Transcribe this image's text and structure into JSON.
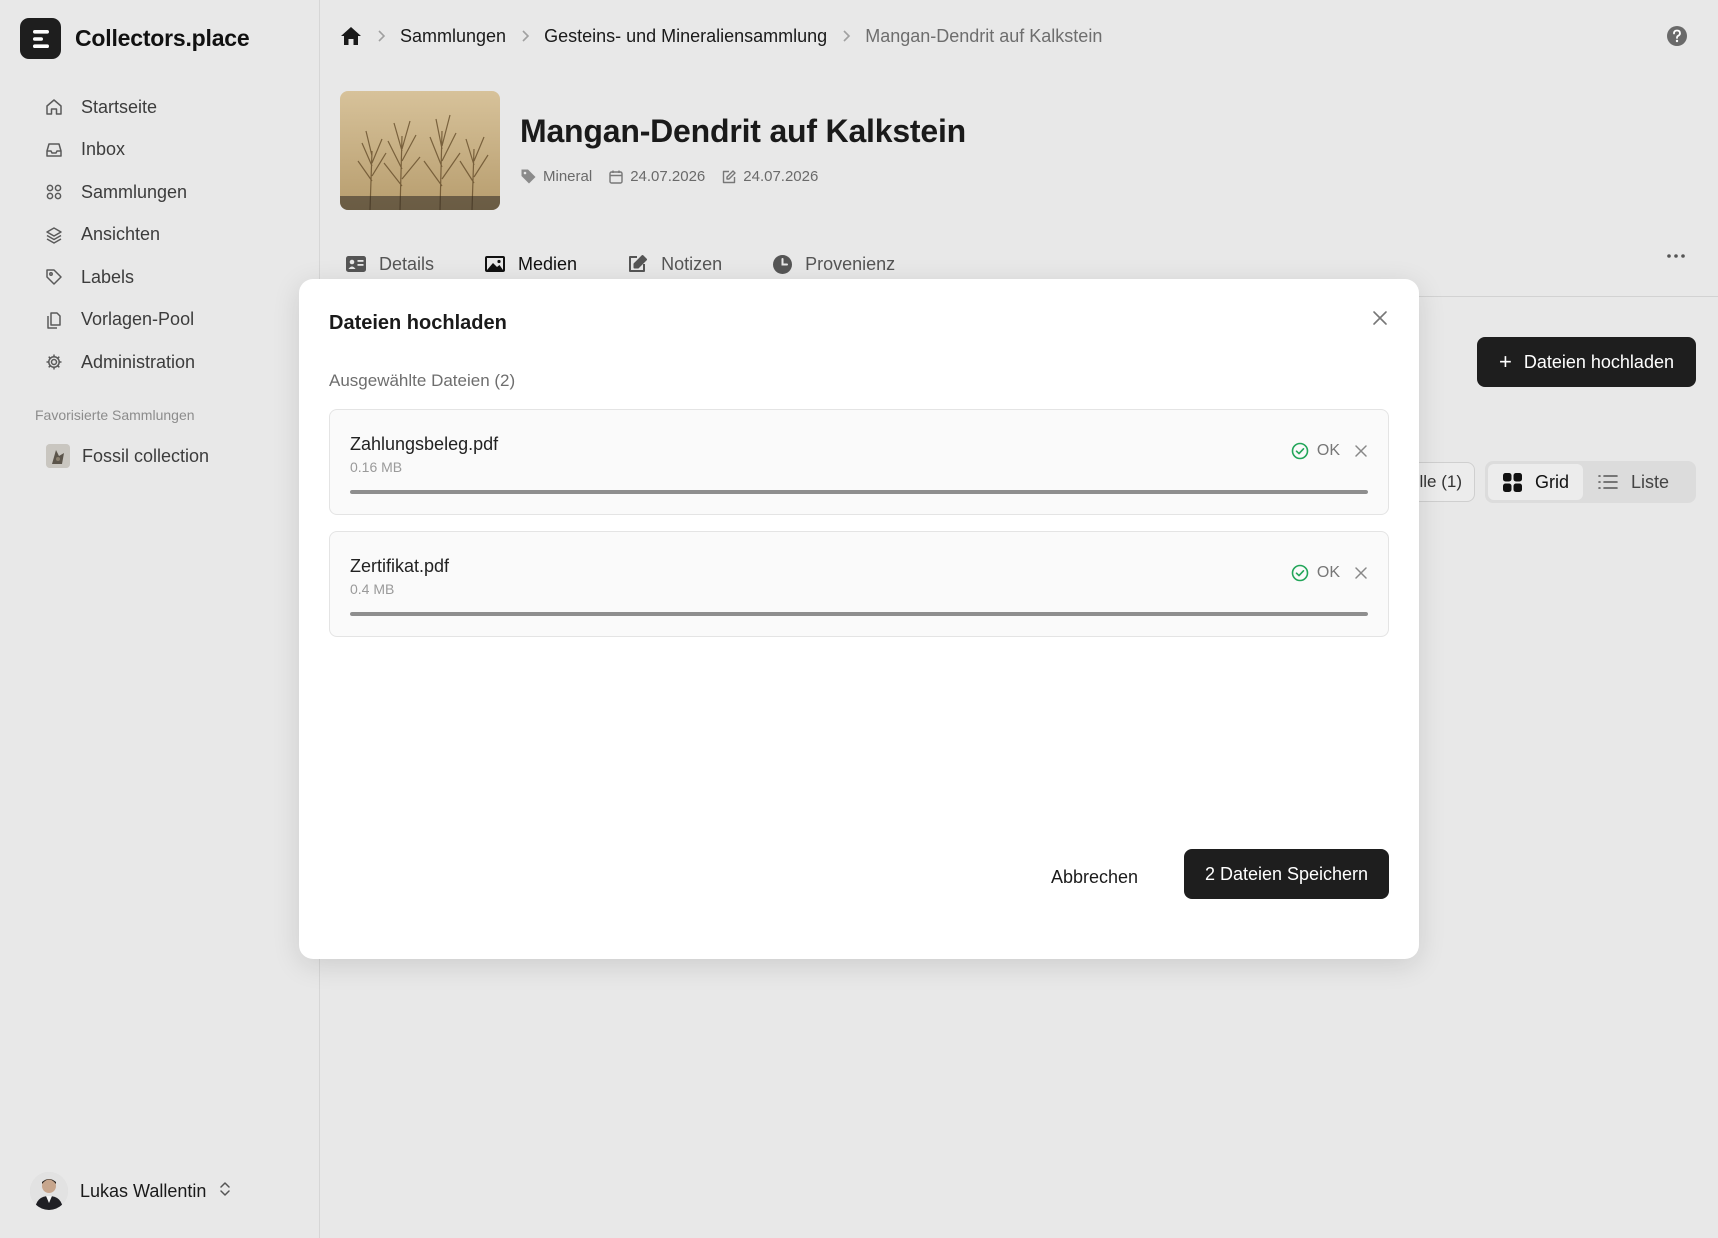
{
  "app": {
    "name": "Collectors.place"
  },
  "sidebar": {
    "items": [
      {
        "label": "Startseite",
        "icon": "home-icon"
      },
      {
        "label": "Inbox",
        "icon": "inbox-icon"
      },
      {
        "label": "Sammlungen",
        "icon": "collections-grid-icon"
      },
      {
        "label": "Ansichten",
        "icon": "layers-icon"
      },
      {
        "label": "Labels",
        "icon": "tag-icon"
      },
      {
        "label": "Vorlagen-Pool",
        "icon": "copy-icon"
      },
      {
        "label": "Administration",
        "icon": "gear-icon"
      }
    ],
    "favorites_title": "Favorisierte Sammlungen",
    "favorites": [
      {
        "label": "Fossil collection"
      }
    ],
    "user": {
      "name": "Lukas Wallentin"
    }
  },
  "breadcrumb": {
    "items": [
      "Sammlungen",
      "Gesteins- und Mineraliensammlung",
      "Mangan-Dendrit auf Kalkstein"
    ]
  },
  "item": {
    "title": "Mangan-Dendrit auf Kalkstein",
    "category": "Mineral",
    "created": "24.07.2026",
    "modified": "24.07.2026"
  },
  "tabs": [
    {
      "label": "Details",
      "icon": "id-card-icon"
    },
    {
      "label": "Medien",
      "icon": "image-icon",
      "active": true
    },
    {
      "label": "Notizen",
      "icon": "edit-icon"
    },
    {
      "label": "Provenienz",
      "icon": "clock-icon"
    }
  ],
  "toolbar": {
    "upload_label": "Dateien hochladen",
    "filter_all_label": "lle (1)",
    "view_grid_label": "Grid",
    "view_list_label": "Liste"
  },
  "modal": {
    "title": "Dateien hochladen",
    "selected_label": "Ausgewählte Dateien (2)",
    "files": [
      {
        "name": "Zahlungsbeleg.pdf",
        "size": "0.16 MB",
        "status": "OK",
        "progress": 1.0
      },
      {
        "name": "Zertifikat.pdf",
        "size": "0.4 MB",
        "status": "OK",
        "progress": 1.0
      }
    ],
    "cancel_label": "Abbrechen",
    "save_label": "2 Dateien Speichern"
  },
  "colors": {
    "accent_dark": "#1e1e1e",
    "status_ok": "#22a559",
    "background": "#e8e8e8"
  }
}
